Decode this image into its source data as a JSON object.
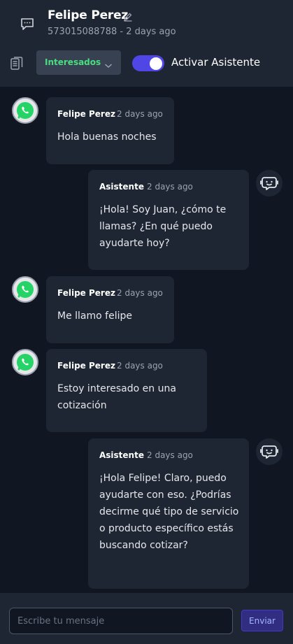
{
  "header": {
    "contact_name": "Felipe Perez",
    "contact_subtitle": "573015088788 - 2 days ago",
    "status_selected": "Interesados",
    "toggle_label": "Activar Asistente",
    "toggle_on": true
  },
  "messages": [
    {
      "author": "Felipe Perez",
      "time": "2 days ago",
      "text": "Hola buenas noches",
      "from": "contact"
    },
    {
      "author": "Asistente",
      "time": "2 days ago",
      "text": "¡Hola! Soy Juan, ¿cómo te llamas? ¿En qué puedo ayudarte hoy?",
      "from": "assistant"
    },
    {
      "author": "Felipe Perez",
      "time": "2 days ago",
      "text": "Me llamo felipe",
      "from": "contact"
    },
    {
      "author": "Felipe Perez",
      "time": "2 days ago",
      "text": "Estoy interesado en una cotización",
      "from": "contact"
    },
    {
      "author": "Asistente",
      "time": "2 days ago",
      "text": "¡Hola Felipe! Claro, puedo ayudarte con eso. ¿Podrías decirme qué tipo de servicio o producto específico estás buscando cotizar?",
      "from": "assistant"
    }
  ],
  "composer": {
    "placeholder": "Escribe tu mensaje",
    "value": "",
    "send_label": "Enviar"
  },
  "colors": {
    "accent": "#4f46e5",
    "status_green": "#4ade80",
    "whatsapp": "#25d366"
  }
}
